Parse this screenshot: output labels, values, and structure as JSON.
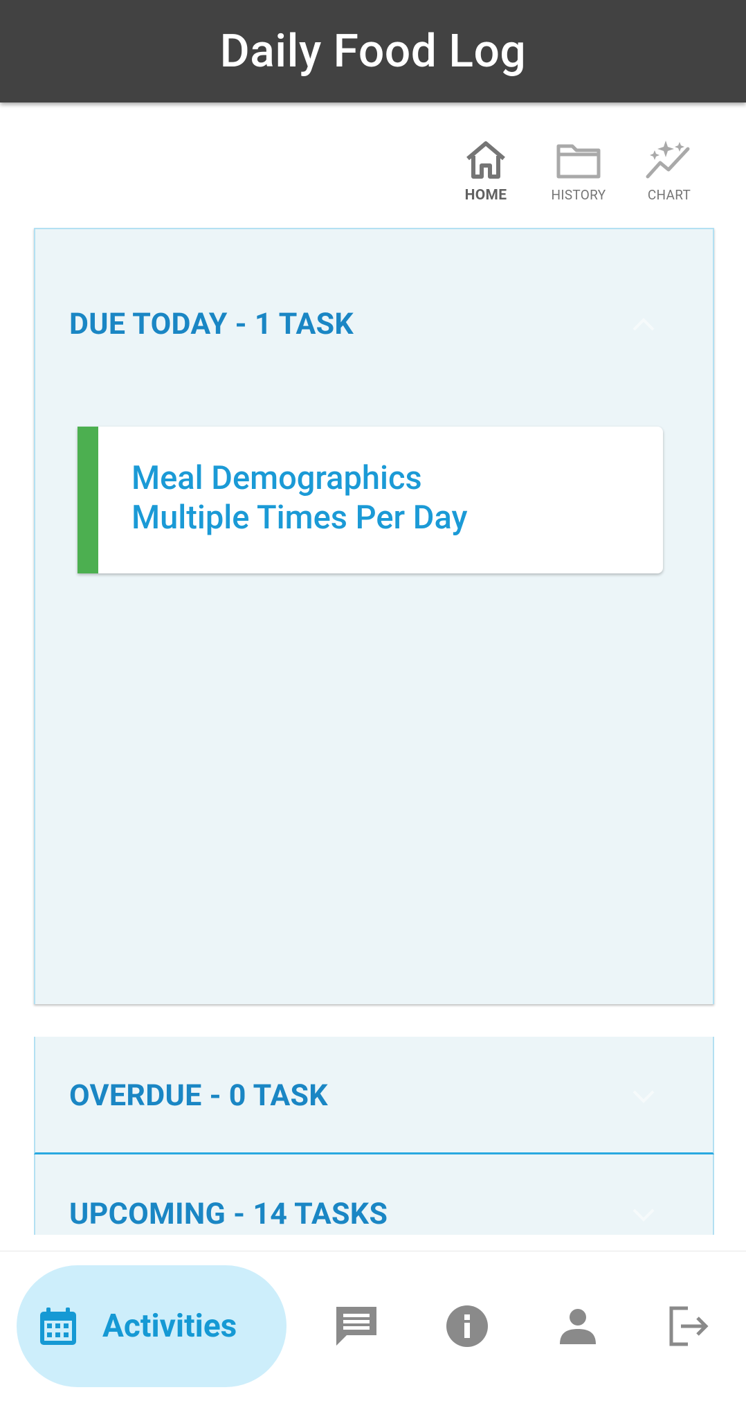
{
  "app": {
    "title": "Daily Food Log"
  },
  "topnav": {
    "items": [
      {
        "label": "HOME",
        "icon": "home-icon",
        "active": true
      },
      {
        "label": "HISTORY",
        "icon": "folder-icon",
        "active": false
      },
      {
        "label": "CHART",
        "icon": "chart-sparkle-icon",
        "active": false
      }
    ]
  },
  "sections": {
    "due": {
      "title": "DUE TODAY - 1 TASK",
      "expanded": true
    },
    "overdue": {
      "title": "OVERDUE - 0 TASK",
      "expanded": false
    },
    "upcoming": {
      "title": "UPCOMING - 14 TASKS",
      "expanded": false
    }
  },
  "tasks": [
    {
      "title_line1": "Meal Demographics",
      "title_line2": "Multiple Times Per Day",
      "status_color": "#4caf50"
    }
  ],
  "bottomnav": {
    "active": {
      "label": "Activities",
      "icon": "calendar-icon"
    },
    "items": [
      {
        "icon": "message-icon"
      },
      {
        "icon": "info-icon"
      },
      {
        "icon": "person-icon"
      },
      {
        "icon": "logout-icon"
      }
    ]
  },
  "colors": {
    "appbar": "#424242",
    "accent": "#1a86c4",
    "task_title": "#1b9ad6",
    "panel_bg": "#ecf5f8",
    "active_pill": "#cdeefb"
  }
}
